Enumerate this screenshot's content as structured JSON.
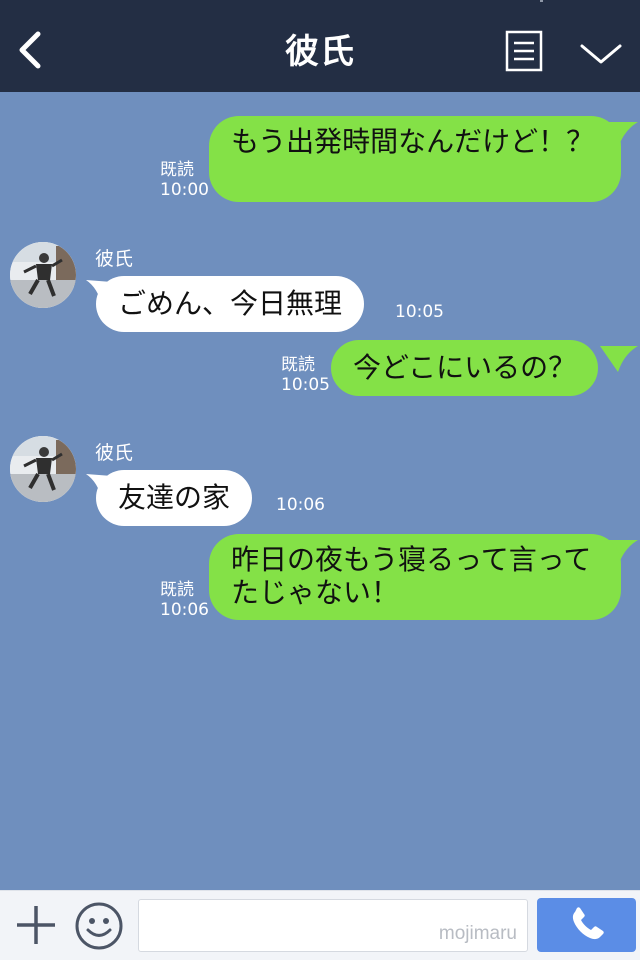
{
  "header": {
    "title": "彼氏"
  },
  "messages": {
    "m1": {
      "text": "もう出発時間なんだけど！？",
      "read": "既読",
      "time": "10:00"
    },
    "m2": {
      "sender": "彼氏",
      "text": "ごめん、今日無理",
      "time": "10:05"
    },
    "m3": {
      "text": "今どこにいるの？",
      "read": "既読",
      "time": "10:05"
    },
    "m4": {
      "sender": "彼氏",
      "text": "友達の家",
      "time": "10:06"
    },
    "m5": {
      "text": "昨日の夜もう寝るって言ってたじゃない！",
      "read": "既読",
      "time": "10:06"
    }
  },
  "footer": {
    "watermark": "mojimaru",
    "input_value": ""
  },
  "colors": {
    "header_bg": "#232e44",
    "chat_bg": "#6f8fbe",
    "outgoing_bubble": "#84e147",
    "incoming_bubble": "#ffffff",
    "call_button": "#5b8de6"
  },
  "icons": [
    "back-chevron-icon",
    "menu-list-icon",
    "chevron-down-icon",
    "plus-icon",
    "emoji-icon",
    "phone-icon"
  ]
}
